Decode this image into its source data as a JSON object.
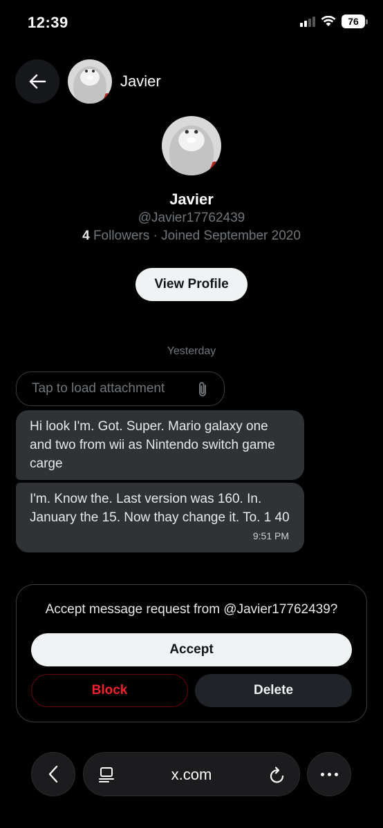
{
  "status_bar": {
    "time": "12:39",
    "battery": "76"
  },
  "header": {
    "name": "Javier",
    "back_icon": "arrow-left-icon"
  },
  "profile": {
    "name": "Javier",
    "handle": "@Javier17762439",
    "followers_count": "4",
    "followers_label": "Followers",
    "joined": " · Joined September 2020",
    "view_profile_label": "View Profile"
  },
  "conversation": {
    "date_separator": "Yesterday",
    "attachment_label": "Tap to load attachment",
    "messages": [
      {
        "text": "Hi look  I'm. Got. Super. Mario galaxy one and two from wii  as Nintendo switch game carge",
        "time": ""
      },
      {
        "text": "I'm. Know the. Last version was 160. In. January the  15. Now thay change it. To. 1 40",
        "time": "9:51 PM"
      }
    ]
  },
  "request": {
    "prompt": "Accept message request from @Javier17762439?",
    "accept_label": "Accept",
    "block_label": "Block",
    "delete_label": "Delete"
  },
  "browser": {
    "url": "x.com"
  },
  "colors": {
    "background": "#000000",
    "block_red": "#f4212e",
    "bubble": "#2f3336",
    "muted": "#71767b"
  }
}
